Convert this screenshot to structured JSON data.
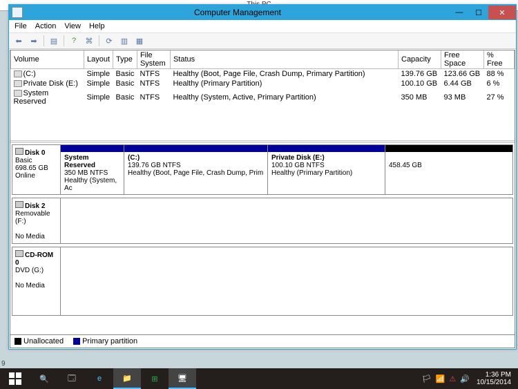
{
  "bg_title": "This PC",
  "window": {
    "title": "Computer Management",
    "menu": {
      "file": "File",
      "action": "Action",
      "view": "View",
      "help": "Help"
    }
  },
  "columns": {
    "volume": "Volume",
    "layout": "Layout",
    "type": "Type",
    "fs": "File System",
    "status": "Status",
    "capacity": "Capacity",
    "free": "Free Space",
    "pctfree": "% Free"
  },
  "volumes": [
    {
      "name": "(C:)",
      "layout": "Simple",
      "type": "Basic",
      "fs": "NTFS",
      "status": "Healthy (Boot, Page File, Crash Dump, Primary Partition)",
      "capacity": "139.76 GB",
      "free": "123.66 GB",
      "pctfree": "88 %"
    },
    {
      "name": "Private Disk (E:)",
      "layout": "Simple",
      "type": "Basic",
      "fs": "NTFS",
      "status": "Healthy (Primary Partition)",
      "capacity": "100.10 GB",
      "free": "6.44 GB",
      "pctfree": "6 %"
    },
    {
      "name": "System Reserved",
      "layout": "Simple",
      "type": "Basic",
      "fs": "NTFS",
      "status": "Healthy (System, Active, Primary Partition)",
      "capacity": "350 MB",
      "free": "93 MB",
      "pctfree": "27 %"
    }
  ],
  "disks": {
    "d0": {
      "name": "Disk 0",
      "type": "Basic",
      "size": "698.65 GB",
      "status": "Online",
      "p0": {
        "name": "System Reserved",
        "size": "350 MB NTFS",
        "status": "Healthy (System, Ac"
      },
      "p1": {
        "name": "(C:)",
        "size": "139.76 GB NTFS",
        "status": "Healthy (Boot, Page File, Crash Dump, Prim"
      },
      "p2": {
        "name": "Private Disk  (E:)",
        "size": "100.10 GB NTFS",
        "status": "Healthy (Primary Partition)"
      },
      "p3": {
        "size": "458.45 GB"
      }
    },
    "d2": {
      "name": "Disk 2",
      "type": "Removable (F:)",
      "status": "No Media"
    },
    "cd0": {
      "name": "CD-ROM 0",
      "type": "DVD (G:)",
      "status": "No Media"
    }
  },
  "legend": {
    "unalloc": "Unallocated",
    "primary": "Primary partition"
  },
  "footer_num": "9",
  "tray": {
    "time": "1:36 PM",
    "date": "10/15/2014"
  }
}
